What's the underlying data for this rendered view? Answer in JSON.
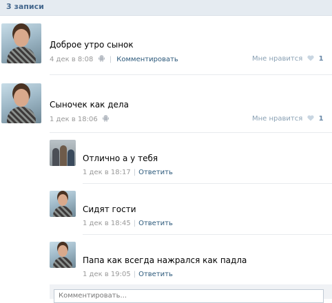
{
  "header": {
    "title": "3 записи"
  },
  "posts": [
    {
      "text": "Доброе утро сынок",
      "date": "4 дек в 8:08",
      "comment_label": "Комментировать",
      "like_label": "Мне нравится",
      "like_count": "1"
    },
    {
      "text": "Сыночек как дела",
      "date": "1 дек в 18:06",
      "like_label": "Мне нравится",
      "like_count": "1"
    }
  ],
  "replies": [
    {
      "text": "Отлично а у тебя",
      "date": "1 дек в 18:17",
      "reply_label": "Ответить"
    },
    {
      "text": "Сидят гости",
      "date": "1 дек в 18:45",
      "reply_label": "Ответить"
    },
    {
      "text": "Папа как всегда нажрался как падла",
      "date": "1 дек в 19:05",
      "reply_label": "Ответить"
    }
  ],
  "comment_box": {
    "placeholder": "Комментировать..."
  },
  "icons": {
    "device": "android-icon",
    "like": "heart-icon"
  },
  "colors": {
    "link": "#2b587a",
    "header_bg": "#e5ebf1",
    "header_text": "#45688e",
    "meta": "#999999"
  }
}
